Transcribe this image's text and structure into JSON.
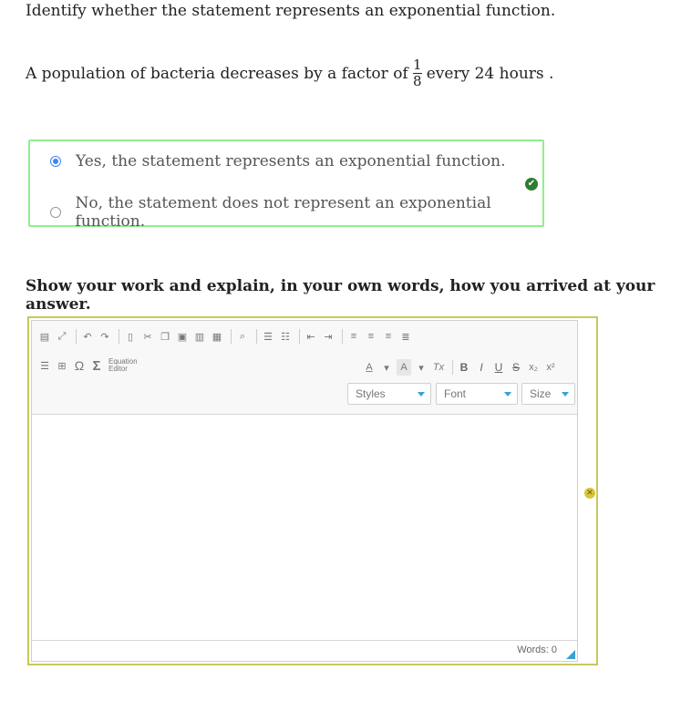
{
  "question": {
    "prompt": "Identify whether the statement represents an exponential function.",
    "statement_before": "A population of bacteria decreases by a factor of",
    "fraction_numerator": "1",
    "fraction_denominator": "8",
    "statement_after": "every 24 hours ."
  },
  "answer_options": [
    {
      "label": "Yes, the statement represents an exponential function.",
      "selected": true
    },
    {
      "label": "No, the statement does not represent an exponential function.",
      "selected": false
    }
  ],
  "correct_badge": "✔",
  "work_section": {
    "heading": "Show your work and explain, in your own words, how you arrived at your answer."
  },
  "editor": {
    "toolbar_icons": [
      "source-icon",
      "maximize-icon",
      "undo-icon",
      "redo-icon",
      "new-page-icon",
      "cut-icon",
      "copy-icon",
      "paste-icon",
      "paste-text-icon",
      "paste-word-icon",
      "find-icon",
      "numbered-list-icon",
      "bulleted-list-icon",
      "outdent-icon",
      "indent-icon",
      "align-left-icon",
      "align-center-icon",
      "align-right-icon",
      "justify-icon"
    ],
    "insert_symbols": {
      "omega": "Ω",
      "sigma": "Σ"
    },
    "equation_editor_line1": "Equation",
    "equation_editor_line2": "Editor",
    "font_color_label": "A",
    "bg_color_label": "A",
    "remove_format_label": "Tx",
    "bold_label": "B",
    "italic_label": "I",
    "underline_label": "U",
    "strike_label": "S",
    "subscript_label": "x₂",
    "superscript_label": "x²",
    "styles_placeholder": "Styles",
    "font_placeholder": "Font",
    "size_placeholder": "Size",
    "word_count": "Words: 0"
  },
  "invalid_badge": "✕",
  "colors": {
    "correct_border": "#90ee90",
    "editor_border": "#c8c85a",
    "radio_selected": "#3b86f0",
    "accent_blue": "#3aa0d8"
  }
}
